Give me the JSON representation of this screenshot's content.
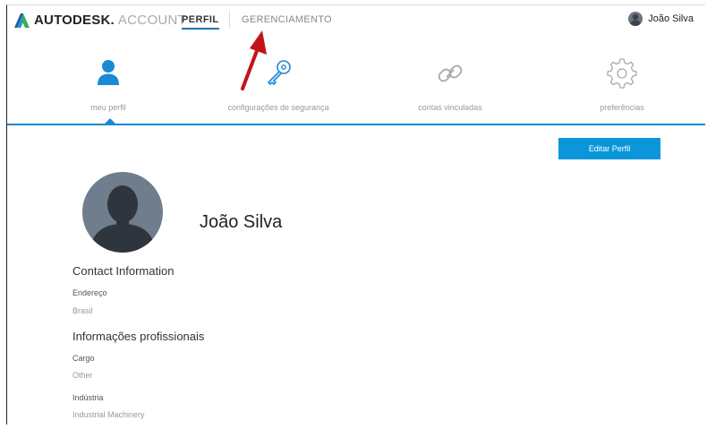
{
  "header": {
    "brand": "AUTODESK.",
    "product": "ACCOUNT",
    "nav": [
      {
        "label": "PERFIL",
        "active": true
      },
      {
        "label": "GERENCIAMENTO",
        "active": false
      }
    ],
    "user_name": "João Silva"
  },
  "tabs": [
    {
      "label": "meu perfil",
      "icon": "user-icon",
      "active": true
    },
    {
      "label": "configurações de segurança",
      "icon": "key-icon",
      "active": false
    },
    {
      "label": "contas vinculadas",
      "icon": "link-icon",
      "active": false
    },
    {
      "label": "preferências",
      "icon": "gear-icon",
      "active": false
    }
  ],
  "edit_button_label": "Editar Perfil",
  "profile_name": "João Silva",
  "contact": {
    "title": "Contact Information",
    "address_label": "Endereço",
    "address_value": "Brasil"
  },
  "professional": {
    "title": "Informações profissionais",
    "role_label": "Cargo",
    "role_value": "Other",
    "industry_label": "Indústria",
    "industry_value": "Industrial Machinery"
  },
  "colors": {
    "accent": "#0a96d8",
    "tab_line": "#1a8ad4",
    "annotation_arrow": "#c0141a"
  }
}
